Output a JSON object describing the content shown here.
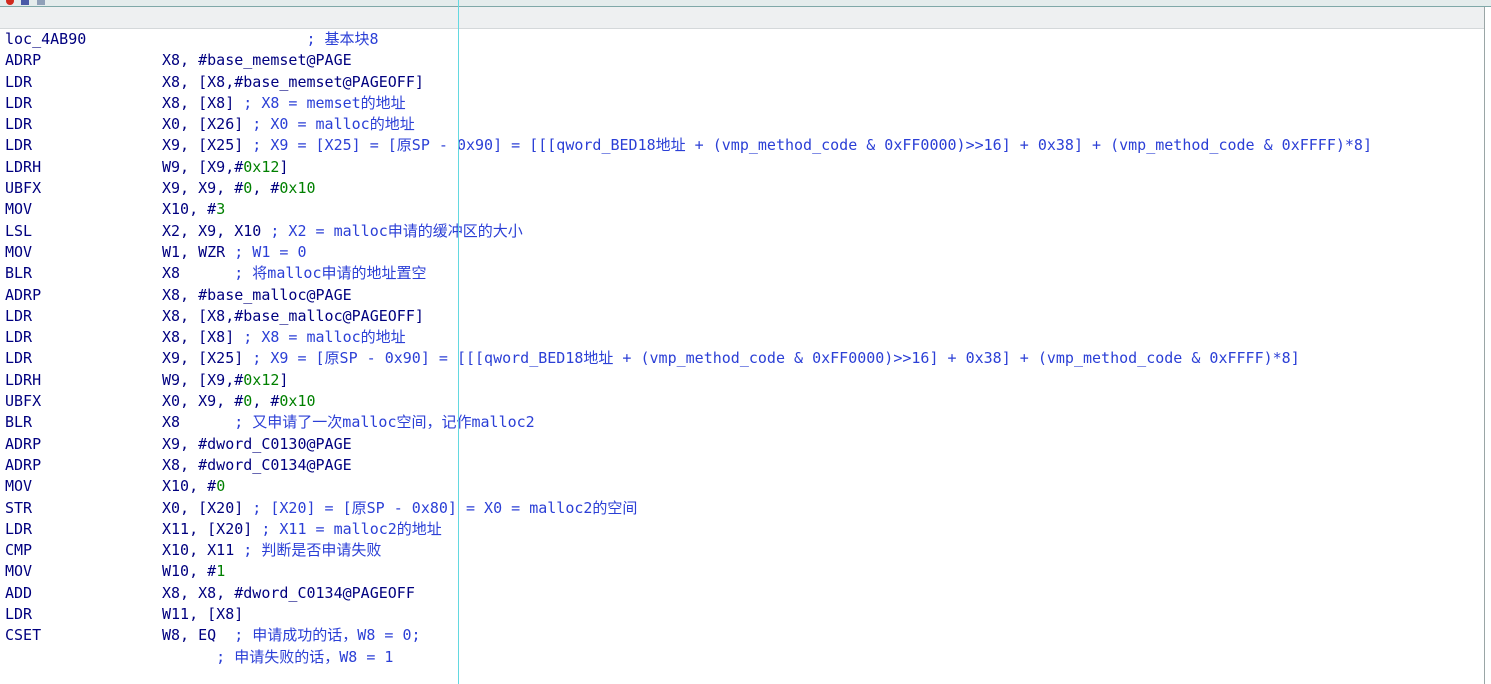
{
  "listing": {
    "rows": [
      {
        "mnem": "loc_4AB90",
        "ops": [
          {
            "t": "",
            "c": "rg"
          },
          {
            "t": "                ; 基本块8",
            "c": "cm"
          }
        ]
      },
      {
        "mnem": "ADRP",
        "ops": [
          {
            "t": "X8, #",
            "c": "rg"
          },
          {
            "t": "base_memset@PAGE",
            "c": "sym"
          }
        ]
      },
      {
        "mnem": "LDR",
        "ops": [
          {
            "t": "X8, [X8,#",
            "c": "rg"
          },
          {
            "t": "base_memset@PAGEOFF",
            "c": "sym"
          },
          {
            "t": "]",
            "c": "rg"
          }
        ]
      },
      {
        "mnem": "LDR",
        "ops": [
          {
            "t": "X8, [X8]",
            "c": "rg"
          },
          {
            "t": " ; X8 = memset的地址",
            "c": "cm"
          }
        ]
      },
      {
        "mnem": "LDR",
        "ops": [
          {
            "t": "X0, [X26]",
            "c": "rg"
          },
          {
            "t": " ; X0 = malloc的地址",
            "c": "cm"
          }
        ]
      },
      {
        "mnem": "LDR",
        "ops": [
          {
            "t": "X9, [X25]",
            "c": "rg"
          },
          {
            "t": " ; X9 = [X25] = [原SP - 0x90] = [[[qword_BED18地址 + (vmp_method_code & 0xFF0000)>>16] + 0x38] + (vmp_method_code & 0xFFFF)*8]",
            "c": "cm"
          }
        ]
      },
      {
        "mnem": "LDRH",
        "ops": [
          {
            "t": "W9, [X9,#",
            "c": "rg"
          },
          {
            "t": "0x12",
            "c": "nm"
          },
          {
            "t": "]",
            "c": "rg"
          }
        ]
      },
      {
        "mnem": "UBFX",
        "ops": [
          {
            "t": "X9, X9, #",
            "c": "rg"
          },
          {
            "t": "0",
            "c": "nm"
          },
          {
            "t": ", #",
            "c": "rg"
          },
          {
            "t": "0x10",
            "c": "nm"
          }
        ]
      },
      {
        "mnem": "MOV",
        "ops": [
          {
            "t": "X10, #",
            "c": "rg"
          },
          {
            "t": "3",
            "c": "nm"
          }
        ]
      },
      {
        "mnem": "LSL",
        "ops": [
          {
            "t": "X2, X9, X10",
            "c": "rg"
          },
          {
            "t": " ; X2 = malloc申请的缓冲区的大小",
            "c": "cm"
          }
        ]
      },
      {
        "mnem": "MOV",
        "ops": [
          {
            "t": "W1, WZR",
            "c": "rg"
          },
          {
            "t": " ; W1 = 0",
            "c": "cm"
          }
        ]
      },
      {
        "mnem": "BLR",
        "ops": [
          {
            "t": "X8",
            "c": "rg"
          },
          {
            "t": "      ; 将malloc申请的地址置空",
            "c": "cm"
          }
        ]
      },
      {
        "mnem": "ADRP",
        "ops": [
          {
            "t": "X8, #",
            "c": "rg"
          },
          {
            "t": "base_malloc@PAGE",
            "c": "sym"
          }
        ]
      },
      {
        "mnem": "LDR",
        "ops": [
          {
            "t": "X8, [X8,#",
            "c": "rg"
          },
          {
            "t": "base_malloc@PAGEOFF",
            "c": "sym"
          },
          {
            "t": "]",
            "c": "rg"
          }
        ]
      },
      {
        "mnem": "LDR",
        "ops": [
          {
            "t": "X8, [X8]",
            "c": "rg"
          },
          {
            "t": " ; X8 = malloc的地址",
            "c": "cm"
          }
        ]
      },
      {
        "mnem": "LDR",
        "ops": [
          {
            "t": "X9, [X25]",
            "c": "rg"
          },
          {
            "t": " ; X9 = [原SP - 0x90] = [[[qword_BED18地址 + (vmp_method_code & 0xFF0000)>>16] + 0x38] + (vmp_method_code & 0xFFFF)*8]",
            "c": "cm"
          }
        ]
      },
      {
        "mnem": "LDRH",
        "ops": [
          {
            "t": "W9, [X9,#",
            "c": "rg"
          },
          {
            "t": "0x12",
            "c": "nm"
          },
          {
            "t": "]",
            "c": "rg"
          }
        ]
      },
      {
        "mnem": "UBFX",
        "ops": [
          {
            "t": "X0, X9, #",
            "c": "rg"
          },
          {
            "t": "0",
            "c": "nm"
          },
          {
            "t": ", #",
            "c": "rg"
          },
          {
            "t": "0x10",
            "c": "nm"
          }
        ]
      },
      {
        "mnem": "BLR",
        "ops": [
          {
            "t": "X8",
            "c": "rg"
          },
          {
            "t": "      ; 又申请了一次malloc空间，记作malloc2",
            "c": "cm"
          }
        ]
      },
      {
        "mnem": "ADRP",
        "ops": [
          {
            "t": "X9, #",
            "c": "rg"
          },
          {
            "t": "dword_C0130@PAGE",
            "c": "sym"
          }
        ]
      },
      {
        "mnem": "ADRP",
        "ops": [
          {
            "t": "X8, #",
            "c": "rg"
          },
          {
            "t": "dword_C0134@PAGE",
            "c": "sym"
          }
        ]
      },
      {
        "mnem": "MOV",
        "ops": [
          {
            "t": "X10, #",
            "c": "rg"
          },
          {
            "t": "0",
            "c": "nm"
          }
        ]
      },
      {
        "mnem": "STR",
        "ops": [
          {
            "t": "X0, [X20]",
            "c": "rg"
          },
          {
            "t": " ; [X20] = [原SP - 0x80] = X0 = malloc2的空间",
            "c": "cm"
          }
        ]
      },
      {
        "mnem": "LDR",
        "ops": [
          {
            "t": "X11, [X20]",
            "c": "rg"
          },
          {
            "t": " ; X11 = malloc2的地址",
            "c": "cm"
          }
        ]
      },
      {
        "mnem": "CMP",
        "ops": [
          {
            "t": "X10, X11",
            "c": "rg"
          },
          {
            "t": " ; 判断是否申请失败",
            "c": "cm"
          }
        ]
      },
      {
        "mnem": "MOV",
        "ops": [
          {
            "t": "W10, #",
            "c": "rg"
          },
          {
            "t": "1",
            "c": "nm"
          }
        ]
      },
      {
        "mnem": "ADD",
        "ops": [
          {
            "t": "X8, X8, #",
            "c": "rg"
          },
          {
            "t": "dword_C0134@PAGEOFF",
            "c": "sym"
          }
        ]
      },
      {
        "mnem": "LDR",
        "ops": [
          {
            "t": "W11, [X8]",
            "c": "rg"
          }
        ]
      },
      {
        "mnem": "CSET",
        "ops": [
          {
            "t": "W8, EQ",
            "c": "rg"
          },
          {
            "t": "  ; 申请成功的话，W8 = 0;",
            "c": "cm"
          }
        ]
      },
      {
        "mnem": "",
        "ops": [
          {
            "t": "      ; 申请失败的话，W8 = 1",
            "c": "cm"
          }
        ]
      }
    ]
  }
}
